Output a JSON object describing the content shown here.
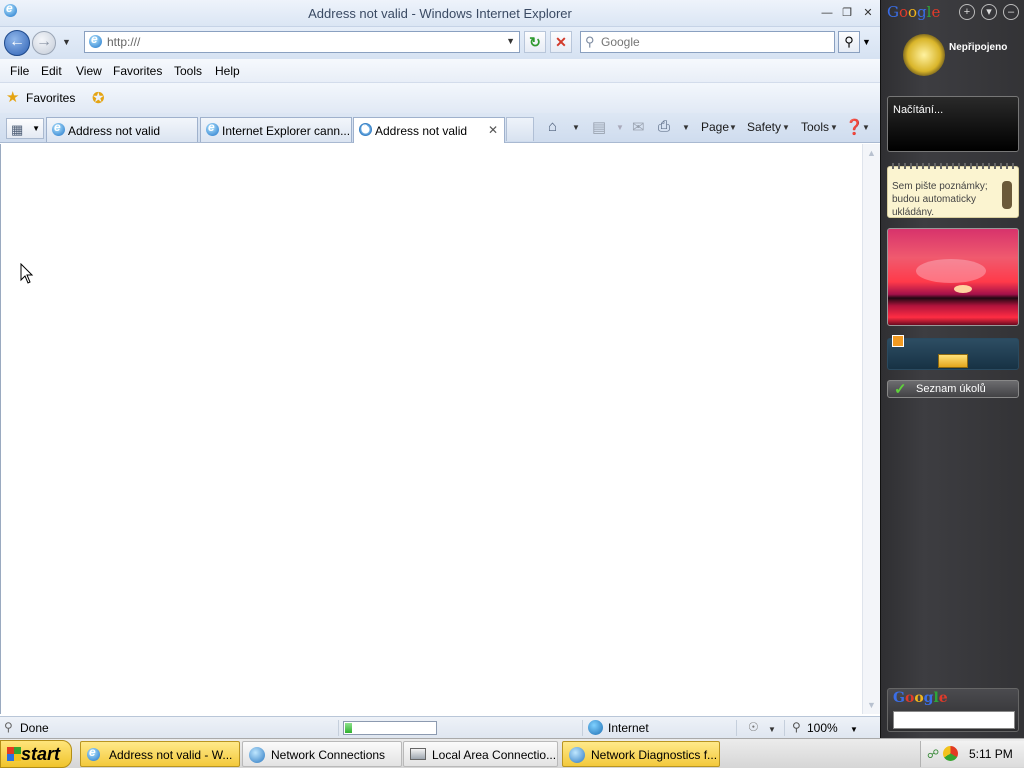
{
  "window": {
    "title": "Address not valid - Windows Internet Explorer"
  },
  "navbar": {
    "address_value": "http:///",
    "search_placeholder": "Google"
  },
  "menu": {
    "items": [
      "File",
      "Edit",
      "View",
      "Favorites",
      "Tools",
      "Help"
    ]
  },
  "favorites": {
    "label": "Favorites"
  },
  "tabs": [
    {
      "label": "Address not valid",
      "active": false
    },
    {
      "label": "Internet Explorer cann...",
      "active": false
    },
    {
      "label": "Address not valid",
      "active": true
    }
  ],
  "commandbar": {
    "page": "Page",
    "safety": "Safety",
    "tools": "Tools"
  },
  "status": {
    "text": "Done",
    "progress": 0.08,
    "zone": "Internet",
    "zoom": "100%"
  },
  "sidebar": {
    "logo": "Google",
    "user_status": "Nepřipojeno",
    "loading_text": "Načítání...",
    "notes_text": "Sem pište poznámky; budou automaticky ukládány.",
    "tasks_label": "Seznam úkolů",
    "search_logo": "Google"
  },
  "taskbar": {
    "start_label": "start",
    "items": [
      {
        "label": "Address not valid - W...",
        "icon": "ie-icon",
        "active": true
      },
      {
        "label": "Network Connections",
        "icon": "network-icon",
        "active": false
      },
      {
        "label": "Local Area Connectio...",
        "icon": "lan-icon",
        "active": false
      },
      {
        "label": "Network Diagnostics f...",
        "icon": "diagnostics-icon",
        "active": true
      }
    ],
    "clock": "5:11 PM"
  },
  "colors": {
    "google_blue": "#3a6ee8",
    "google_red": "#e03a2a",
    "google_yellow": "#f1b51c",
    "google_green": "#2da43a",
    "start_button": "#f0c42c"
  }
}
